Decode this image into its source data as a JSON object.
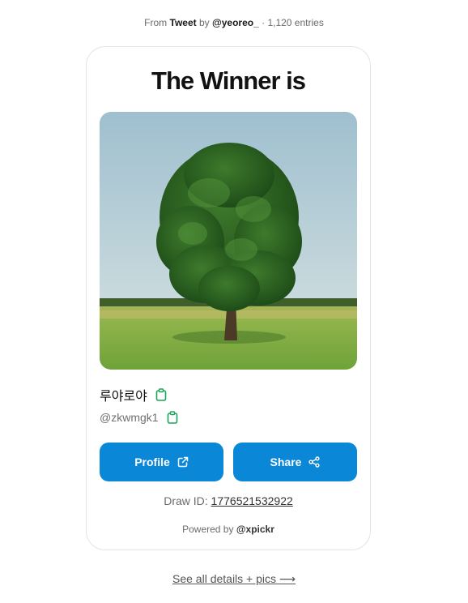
{
  "source": {
    "prefix": "From",
    "platform": "Tweet",
    "by": "by",
    "author": "@yeoreo_",
    "separator": "·",
    "entries": "1,120 entries"
  },
  "card": {
    "title": "The Winner is",
    "winner": {
      "name": "루야로야",
      "handle": "@zkwmgk1"
    },
    "buttons": {
      "profile_label": "Profile",
      "share_label": "Share"
    },
    "draw": {
      "label": "Draw ID:",
      "id": "1776521532922"
    },
    "powered": {
      "prefix": "Powered by",
      "brand": "@xpickr"
    }
  },
  "footer": {
    "details_link": "See all details + pics ⟶"
  },
  "icons": {
    "copy": "clipboard-icon",
    "profile": "external-link-icon",
    "share": "share-icon"
  },
  "colors": {
    "accent": "#0b87d8",
    "copy_icon": "#19a55a"
  }
}
